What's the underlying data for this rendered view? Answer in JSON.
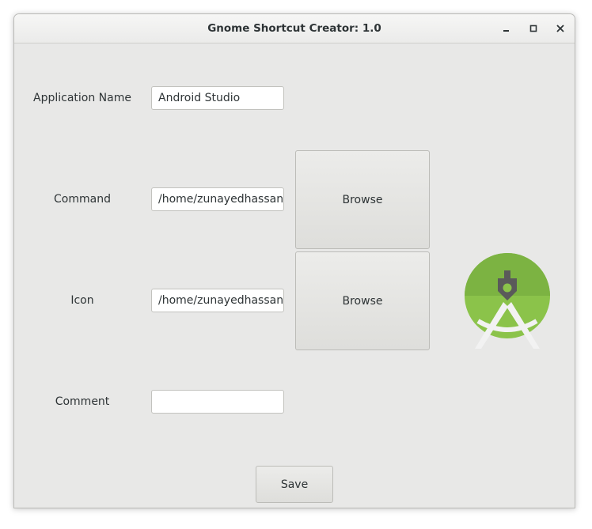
{
  "window": {
    "title": "Gnome Shortcut Creator: 1.0",
    "controls": [
      "minimize-icon",
      "maximize-icon",
      "close-icon"
    ]
  },
  "form": {
    "app_name_label": "Application Name",
    "app_name_value": "Android Studio",
    "command_label": "Command",
    "command_value": "/home/zunayedhassan/",
    "command_browse": "Browse",
    "icon_label": "Icon",
    "icon_value": "/home/zunayedhassan/",
    "icon_browse": "Browse",
    "comment_label": "Comment",
    "comment_value": "",
    "save_label": "Save"
  },
  "preview_icon": "android-studio-icon",
  "colors": {
    "icon_green_light": "#8bc34a",
    "icon_green_dark": "#6da536",
    "icon_gray": "#5a5a5a",
    "icon_white": "#f2f2f2"
  }
}
